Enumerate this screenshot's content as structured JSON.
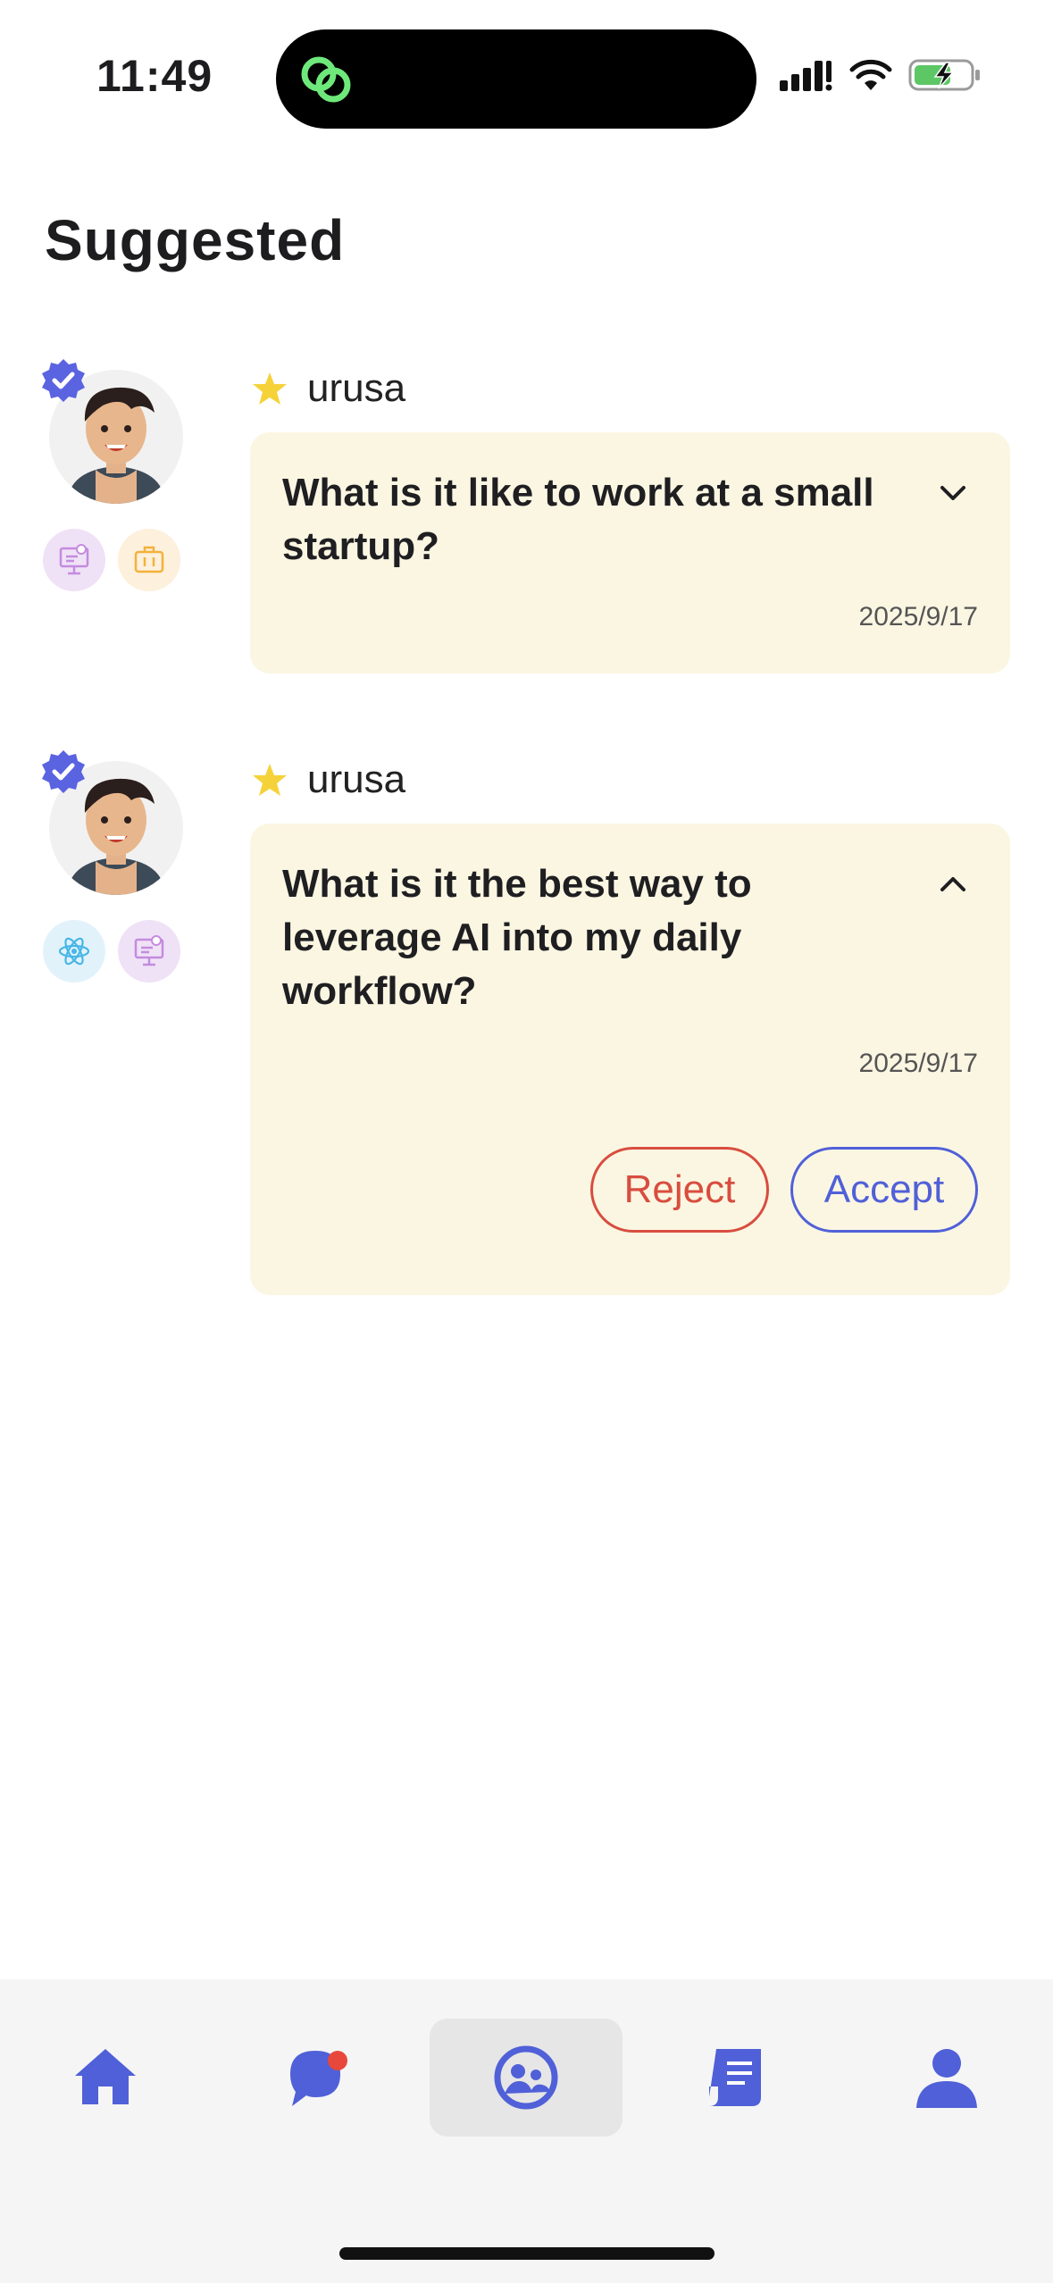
{
  "status_bar": {
    "time": "11:49"
  },
  "page": {
    "title": "Suggested"
  },
  "suggestions": [
    {
      "username": "urusa",
      "question": "What is it like to work at a small startup?",
      "date": "2025/9/17",
      "expanded": false,
      "skill_icons": [
        "presentation-icon",
        "briefcase-icon"
      ]
    },
    {
      "username": "urusa",
      "question": "What is it the best way to leverage AI into my daily workflow?",
      "date": "2025/9/17",
      "expanded": true,
      "skill_icons": [
        "atom-icon",
        "presentation-icon"
      ],
      "reject_label": "Reject",
      "accept_label": "Accept"
    }
  ],
  "bottom_nav": {
    "items": [
      "home-icon",
      "chat-icon",
      "community-icon",
      "notes-icon",
      "profile-icon"
    ],
    "active": "community-icon",
    "unread_dot_on": "chat-icon"
  },
  "colors": {
    "accent": "#5060d8",
    "card_bg": "#fbf6e2",
    "reject": "#d84d3f",
    "star": "#f6d23a",
    "notification": "#e8483b"
  }
}
